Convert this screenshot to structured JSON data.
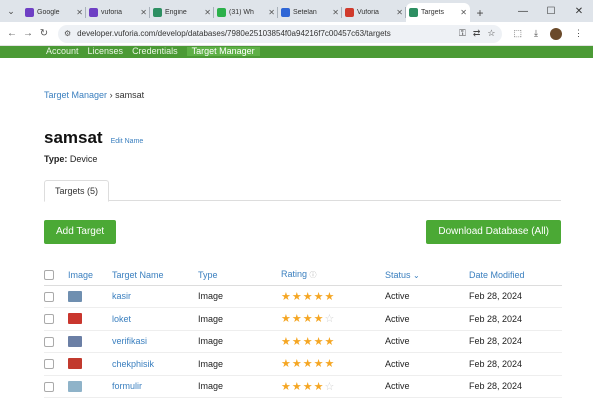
{
  "browser": {
    "tabs": [
      {
        "label": "Google",
        "color": "#6e3fc4"
      },
      {
        "label": "vuforia",
        "color": "#6e3fc4"
      },
      {
        "label": "Engine",
        "color": "#2d8f62"
      },
      {
        "label": "(31) Wh",
        "color": "#2bb04a"
      },
      {
        "label": "Setelan",
        "color": "#2f66d6"
      },
      {
        "label": "Vuforia",
        "color": "#d03a2c"
      },
      {
        "label": "Targets",
        "color": "#2d8f62",
        "active": true
      }
    ],
    "new_tab_label": "+",
    "url": "developer.vuforia.com/develop/databases/7980e25103854f0a94216f7c00457c63/targets"
  },
  "site_nav": {
    "items": [
      "Account",
      "Licenses",
      "Credentials",
      "Target Manager"
    ]
  },
  "breadcrumb": {
    "root": "Target Manager",
    "separator": "›",
    "current": "samsat"
  },
  "database": {
    "name": "samsat",
    "edit_label": "Edit Name",
    "type_label": "Type:",
    "type_value": "Device"
  },
  "tab_targets": "Targets (5)",
  "buttons": {
    "add_target": "Add Target",
    "download": "Download Database (All)"
  },
  "table": {
    "headers": {
      "image": "Image",
      "name": "Target Name",
      "type": "Type",
      "rating": "Rating",
      "status": "Status",
      "date": "Date Modified"
    },
    "rows": [
      {
        "name": "kasir",
        "type": "Image",
        "rating": 5,
        "status": "Active",
        "date": "Feb 28, 2024",
        "thumb_color": "#6f8fb0"
      },
      {
        "name": "loket",
        "type": "Image",
        "rating": 4,
        "status": "Active",
        "date": "Feb 28, 2024",
        "thumb_color": "#c9362e"
      },
      {
        "name": "verifikasi",
        "type": "Image",
        "rating": 5,
        "status": "Active",
        "date": "Feb 28, 2024",
        "thumb_color": "#6b7fa5"
      },
      {
        "name": "chekphisik",
        "type": "Image",
        "rating": 5,
        "status": "Active",
        "date": "Feb 28, 2024",
        "thumb_color": "#c23a2e"
      },
      {
        "name": "formulir",
        "type": "Image",
        "rating": 4,
        "status": "Active",
        "date": "Feb 28, 2024",
        "thumb_color": "#8fb3c9"
      }
    ]
  },
  "colors": {
    "brand_green": "#4ba935",
    "link_blue": "#3a7fbf",
    "star": "#f5a623"
  }
}
